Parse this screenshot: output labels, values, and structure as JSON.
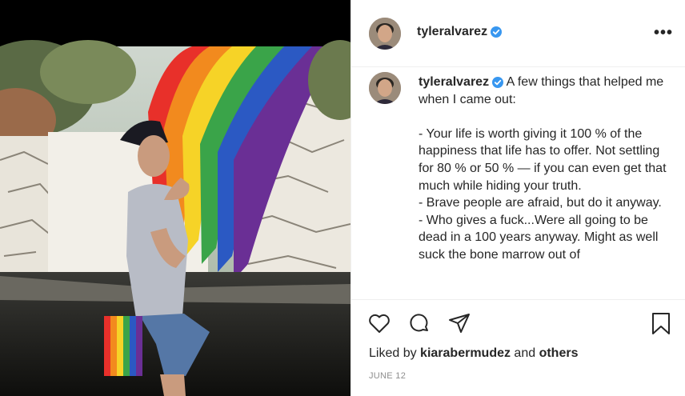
{
  "post": {
    "username": "tyleralvarez",
    "caption_user": "tyleralvarez",
    "caption_text": " A few things that helped me when I came out:\n\n- Your life is worth giving it 100 % of the happiness that life has to offer. Not settling for 80 % or 50 % — if you can even get that much while hiding your truth.\n- Brave people are afraid, but do it anyway.\n- Who gives a fuck...Were all going to be dead in a 100 years anyway. Might as well suck the bone marrow out of",
    "liked_by_prefix": "Liked by ",
    "liked_by_user": "kiarabermudez",
    "liked_by_and": " and ",
    "liked_by_others": "others",
    "date": "JUNE 12",
    "more_label": "•••"
  },
  "icons": {
    "verified": "verified-badge-icon",
    "like": "heart-icon",
    "comment": "comment-bubble-icon",
    "share": "paper-plane-icon",
    "save": "bookmark-icon",
    "more": "more-options-icon"
  },
  "colors": {
    "verified_blue": "#3897f0",
    "text": "#262626",
    "muted": "#8e8e8e"
  }
}
